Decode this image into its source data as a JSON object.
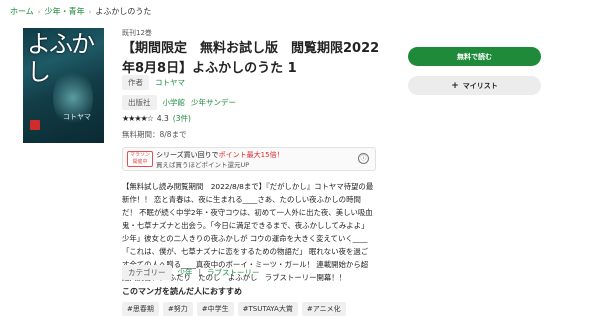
{
  "breadcrumb": {
    "items": [
      "ホーム",
      "少年・青年"
    ],
    "current": "よふかしのうた",
    "separator": "›"
  },
  "cover": {
    "title_text": "よふかし",
    "author_text": "コトヤマ"
  },
  "book": {
    "volume_info": "既刊12巻",
    "title": "【期間限定　無料お試し版　閲覧期限2022年8月8日】よふかしのうた 1",
    "author_label": "作者",
    "author": "コトヤマ",
    "publisher_label": "出版社",
    "publisher": "小学館",
    "imprint": "少年サンデー",
    "stars": "★★★★☆",
    "rating": "4.3",
    "reviews": "(3件)",
    "free_period": "無料期間：8/8まで"
  },
  "promo": {
    "tag": "マラソン開催中",
    "line1_prefix": "シリーズ買い回りで",
    "line1_highlight": "ポイント最大15倍！",
    "line2": "買えば買うほどポイント還元UP",
    "info_icon": "ⓘ"
  },
  "description": "【無料試し読み閲覧期間　2022/8/8まで】『だがしかし』コトヤマ待望の最新作！！ 恋と青春は、夜に生まれる____さあ、たのしい夜ふかしの時間だ！ 不眠が続く中学2年・夜守コウは、初めて一人外に出た夜、美しい吸血鬼・七草ナズナと出会う。「今日に満足できるまで、夜ふかししてみよよ」少年」彼女との二人きりの夜ふかしが コウの運命を大きく変えていく____「これは、僕が、七草ナズナに恋をするための物語だ」 眠れない夜を過ごす全ての人へ贈る____真夜中のボーイ・ミーツ・ガール！ 連載開始から超絶大反響！！ ふたり　たのし　よふかし　ラブストーリー開幕！！",
  "category": {
    "label": "カテゴリー",
    "items": [
      "少年",
      "ラブストーリー"
    ]
  },
  "recommend": {
    "title": "このマンガを読んだ人におすすめ",
    "tags": [
      "#思春期",
      "#努力",
      "#中学生",
      "#TSUTAYA大賞",
      "#アニメ化"
    ]
  },
  "actions": {
    "read_free": "無料で読む",
    "my_list": "マイリスト",
    "plus_icon": "+"
  },
  "colors": {
    "accent_green": "#1f8a3a",
    "link_green": "#1a8a3c",
    "promo_red": "#e0252c",
    "cover_teal": "#1e5a66"
  }
}
